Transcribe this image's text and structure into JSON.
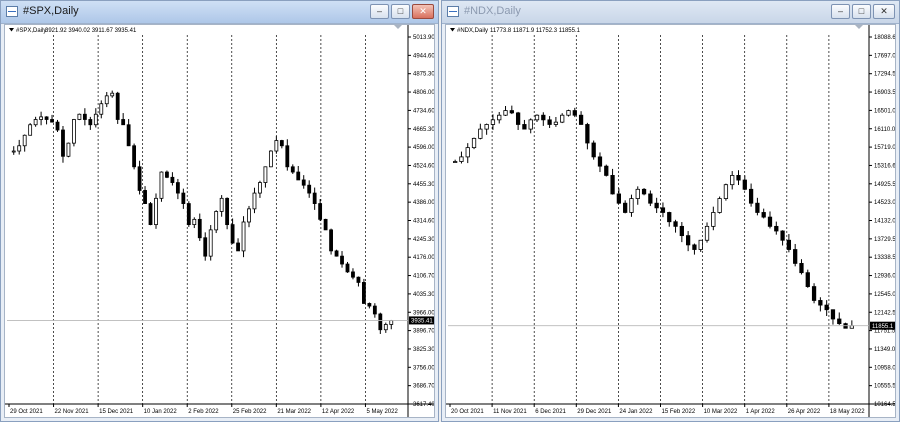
{
  "windows": [
    {
      "title": "#SPX,Daily",
      "symbol_label": "#SPX,Daily",
      "ohlc_label": "3921.92 3940.02 3911.67 3935.41",
      "current_price": "3935.41",
      "price_axis": [
        "5013.90",
        "4944.60",
        "4875.30",
        "4806.00",
        "4734.60",
        "4665.30",
        "4596.00",
        "4524.60",
        "4455.30",
        "4386.00",
        "4314.60",
        "4245.30",
        "4176.00",
        "4106.70",
        "4035.30",
        "3966.00",
        "3896.70",
        "3825.30",
        "3756.00",
        "3686.70",
        "3617.40"
      ],
      "date_axis": [
        "29 Oct 2021",
        "22 Nov 2021",
        "15 Dec 2021",
        "10 Jan 2022",
        "2 Feb 2022",
        "25 Feb 2022",
        "21 Mar 2022",
        "12 Apr 2022",
        "5 May 2022"
      ],
      "active": true
    },
    {
      "title": "#NDX,Daily",
      "symbol_label": "#NDX,Daily",
      "ohlc_label": "11773.8 11871.9 11752.3 11855.1",
      "current_price": "11855.1",
      "price_axis": [
        "18088.6",
        "17697.0",
        "17294.5",
        "16903.5",
        "16501.0",
        "16110.0",
        "15719.0",
        "15316.6",
        "14925.5",
        "14523.0",
        "14132.0",
        "13729.5",
        "13338.5",
        "12936.0",
        "12545.0",
        "12142.5",
        "11751.5",
        "11349.0",
        "10958.0",
        "10555.5",
        "10164.5"
      ],
      "date_axis": [
        "20 Oct 2021",
        "11 Nov 2021",
        "6 Dec 2021",
        "29 Dec 2021",
        "24 Jan 2022",
        "15 Feb 2022",
        "10 Mar 2022",
        "1 Apr 2022",
        "26 Apr 2022",
        "18 May 2022"
      ],
      "active": false
    }
  ],
  "window_buttons": {
    "minimize": "–",
    "maximize": "□",
    "close": "✕"
  },
  "chart_data": [
    {
      "type": "candlestick",
      "title": "#SPX,Daily",
      "ylim": [
        3617.4,
        5013.9
      ],
      "x": [
        "29 Oct 2021",
        "22 Nov 2021",
        "15 Dec 2021",
        "10 Jan 2022",
        "2 Feb 2022",
        "25 Feb 2022",
        "21 Mar 2022",
        "12 Apr 2022",
        "5 May 2022"
      ],
      "close_path": [
        4580,
        4600,
        4640,
        4680,
        4700,
        4710,
        4700,
        4690,
        4660,
        4560,
        4610,
        4700,
        4720,
        4700,
        4680,
        4720,
        4760,
        4790,
        4800,
        4700,
        4680,
        4600,
        4520,
        4430,
        4380,
        4300,
        4400,
        4500,
        4480,
        4460,
        4420,
        4380,
        4300,
        4320,
        4250,
        4180,
        4280,
        4350,
        4400,
        4300,
        4230,
        4200,
        4310,
        4360,
        4420,
        4460,
        4520,
        4580,
        4620,
        4600,
        4520,
        4500,
        4470,
        4450,
        4420,
        4380,
        4320,
        4280,
        4200,
        4180,
        4150,
        4120,
        4100,
        4080,
        4000,
        3990,
        3960,
        3900,
        3920,
        3935
      ],
      "current": 3935.41,
      "grid": true
    },
    {
      "type": "candlestick",
      "title": "#NDX,Daily",
      "ylim": [
        10164.5,
        18088.6
      ],
      "x": [
        "20 Oct 2021",
        "11 Nov 2021",
        "6 Dec 2021",
        "29 Dec 2021",
        "24 Jan 2022",
        "15 Feb 2022",
        "10 Mar 2022",
        "1 Apr 2022",
        "26 Apr 2022",
        "18 May 2022"
      ],
      "close_path": [
        15400,
        15500,
        15700,
        15900,
        16100,
        16200,
        16300,
        16400,
        16500,
        16450,
        16200,
        16100,
        16300,
        16400,
        16300,
        16200,
        16250,
        16400,
        16500,
        16400,
        16200,
        15800,
        15500,
        15300,
        15100,
        14700,
        14500,
        14300,
        14600,
        14800,
        14700,
        14500,
        14400,
        14300,
        14100,
        14000,
        13800,
        13600,
        13500,
        13700,
        14000,
        14300,
        14600,
        14900,
        15100,
        15000,
        14800,
        14500,
        14300,
        14200,
        14000,
        13900,
        13700,
        13500,
        13200,
        13000,
        12700,
        12400,
        12300,
        12200,
        12000,
        11900,
        11800,
        11855
      ],
      "current": 11855.1,
      "grid": true
    }
  ]
}
